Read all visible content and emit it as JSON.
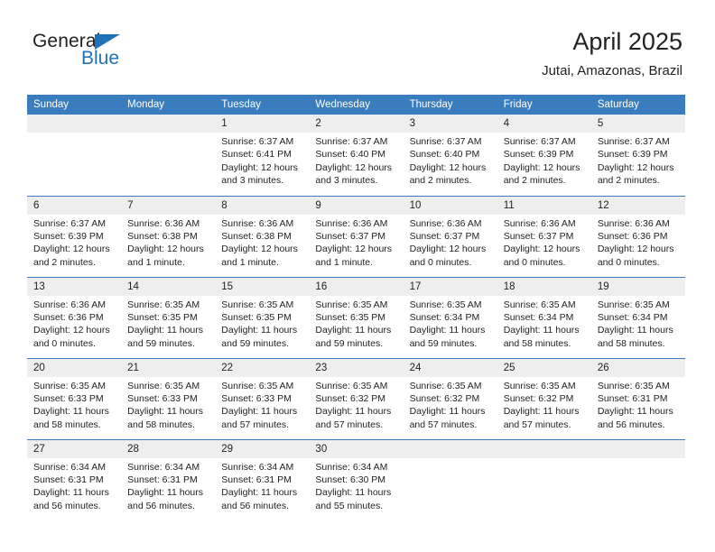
{
  "brand": {
    "name_part1": "General",
    "name_part2": "Blue",
    "triangle_color": "#1f72b8"
  },
  "header": {
    "title": "April 2025",
    "subtitle": "Jutai, Amazonas, Brazil",
    "accent_color": "#3a7dbf"
  },
  "weekdays": [
    "Sunday",
    "Monday",
    "Tuesday",
    "Wednesday",
    "Thursday",
    "Friday",
    "Saturday"
  ],
  "labels": {
    "sunrise": "Sunrise:",
    "sunset": "Sunset:",
    "daylight": "Daylight:"
  },
  "weeks": [
    [
      {
        "day": "",
        "empty": true
      },
      {
        "day": "",
        "empty": true
      },
      {
        "day": "1",
        "sunrise": "Sunrise: 6:37 AM",
        "sunset": "Sunset: 6:41 PM",
        "daylight": "Daylight: 12 hours and 3 minutes."
      },
      {
        "day": "2",
        "sunrise": "Sunrise: 6:37 AM",
        "sunset": "Sunset: 6:40 PM",
        "daylight": "Daylight: 12 hours and 3 minutes."
      },
      {
        "day": "3",
        "sunrise": "Sunrise: 6:37 AM",
        "sunset": "Sunset: 6:40 PM",
        "daylight": "Daylight: 12 hours and 2 minutes."
      },
      {
        "day": "4",
        "sunrise": "Sunrise: 6:37 AM",
        "sunset": "Sunset: 6:39 PM",
        "daylight": "Daylight: 12 hours and 2 minutes."
      },
      {
        "day": "5",
        "sunrise": "Sunrise: 6:37 AM",
        "sunset": "Sunset: 6:39 PM",
        "daylight": "Daylight: 12 hours and 2 minutes."
      }
    ],
    [
      {
        "day": "6",
        "sunrise": "Sunrise: 6:37 AM",
        "sunset": "Sunset: 6:39 PM",
        "daylight": "Daylight: 12 hours and 2 minutes."
      },
      {
        "day": "7",
        "sunrise": "Sunrise: 6:36 AM",
        "sunset": "Sunset: 6:38 PM",
        "daylight": "Daylight: 12 hours and 1 minute."
      },
      {
        "day": "8",
        "sunrise": "Sunrise: 6:36 AM",
        "sunset": "Sunset: 6:38 PM",
        "daylight": "Daylight: 12 hours and 1 minute."
      },
      {
        "day": "9",
        "sunrise": "Sunrise: 6:36 AM",
        "sunset": "Sunset: 6:37 PM",
        "daylight": "Daylight: 12 hours and 1 minute."
      },
      {
        "day": "10",
        "sunrise": "Sunrise: 6:36 AM",
        "sunset": "Sunset: 6:37 PM",
        "daylight": "Daylight: 12 hours and 0 minutes."
      },
      {
        "day": "11",
        "sunrise": "Sunrise: 6:36 AM",
        "sunset": "Sunset: 6:37 PM",
        "daylight": "Daylight: 12 hours and 0 minutes."
      },
      {
        "day": "12",
        "sunrise": "Sunrise: 6:36 AM",
        "sunset": "Sunset: 6:36 PM",
        "daylight": "Daylight: 12 hours and 0 minutes."
      }
    ],
    [
      {
        "day": "13",
        "sunrise": "Sunrise: 6:36 AM",
        "sunset": "Sunset: 6:36 PM",
        "daylight": "Daylight: 12 hours and 0 minutes."
      },
      {
        "day": "14",
        "sunrise": "Sunrise: 6:35 AM",
        "sunset": "Sunset: 6:35 PM",
        "daylight": "Daylight: 11 hours and 59 minutes."
      },
      {
        "day": "15",
        "sunrise": "Sunrise: 6:35 AM",
        "sunset": "Sunset: 6:35 PM",
        "daylight": "Daylight: 11 hours and 59 minutes."
      },
      {
        "day": "16",
        "sunrise": "Sunrise: 6:35 AM",
        "sunset": "Sunset: 6:35 PM",
        "daylight": "Daylight: 11 hours and 59 minutes."
      },
      {
        "day": "17",
        "sunrise": "Sunrise: 6:35 AM",
        "sunset": "Sunset: 6:34 PM",
        "daylight": "Daylight: 11 hours and 59 minutes."
      },
      {
        "day": "18",
        "sunrise": "Sunrise: 6:35 AM",
        "sunset": "Sunset: 6:34 PM",
        "daylight": "Daylight: 11 hours and 58 minutes."
      },
      {
        "day": "19",
        "sunrise": "Sunrise: 6:35 AM",
        "sunset": "Sunset: 6:34 PM",
        "daylight": "Daylight: 11 hours and 58 minutes."
      }
    ],
    [
      {
        "day": "20",
        "sunrise": "Sunrise: 6:35 AM",
        "sunset": "Sunset: 6:33 PM",
        "daylight": "Daylight: 11 hours and 58 minutes."
      },
      {
        "day": "21",
        "sunrise": "Sunrise: 6:35 AM",
        "sunset": "Sunset: 6:33 PM",
        "daylight": "Daylight: 11 hours and 58 minutes."
      },
      {
        "day": "22",
        "sunrise": "Sunrise: 6:35 AM",
        "sunset": "Sunset: 6:33 PM",
        "daylight": "Daylight: 11 hours and 57 minutes."
      },
      {
        "day": "23",
        "sunrise": "Sunrise: 6:35 AM",
        "sunset": "Sunset: 6:32 PM",
        "daylight": "Daylight: 11 hours and 57 minutes."
      },
      {
        "day": "24",
        "sunrise": "Sunrise: 6:35 AM",
        "sunset": "Sunset: 6:32 PM",
        "daylight": "Daylight: 11 hours and 57 minutes."
      },
      {
        "day": "25",
        "sunrise": "Sunrise: 6:35 AM",
        "sunset": "Sunset: 6:32 PM",
        "daylight": "Daylight: 11 hours and 57 minutes."
      },
      {
        "day": "26",
        "sunrise": "Sunrise: 6:35 AM",
        "sunset": "Sunset: 6:31 PM",
        "daylight": "Daylight: 11 hours and 56 minutes."
      }
    ],
    [
      {
        "day": "27",
        "sunrise": "Sunrise: 6:34 AM",
        "sunset": "Sunset: 6:31 PM",
        "daylight": "Daylight: 11 hours and 56 minutes."
      },
      {
        "day": "28",
        "sunrise": "Sunrise: 6:34 AM",
        "sunset": "Sunset: 6:31 PM",
        "daylight": "Daylight: 11 hours and 56 minutes."
      },
      {
        "day": "29",
        "sunrise": "Sunrise: 6:34 AM",
        "sunset": "Sunset: 6:31 PM",
        "daylight": "Daylight: 11 hours and 56 minutes."
      },
      {
        "day": "30",
        "sunrise": "Sunrise: 6:34 AM",
        "sunset": "Sunset: 6:30 PM",
        "daylight": "Daylight: 11 hours and 55 minutes."
      },
      {
        "day": "",
        "empty": true
      },
      {
        "day": "",
        "empty": true
      },
      {
        "day": "",
        "empty": true
      }
    ]
  ]
}
